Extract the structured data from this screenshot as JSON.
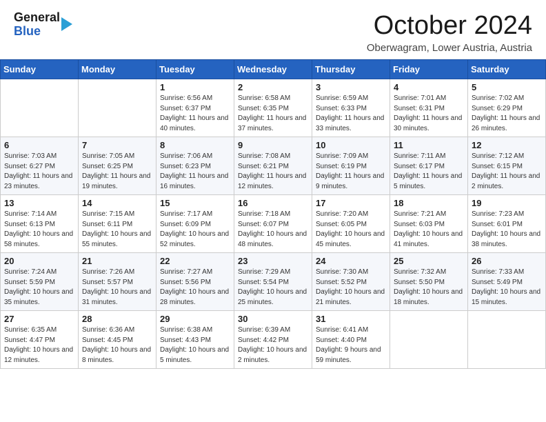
{
  "header": {
    "logo_line1": "General",
    "logo_line2": "Blue",
    "month_title": "October 2024",
    "location": "Oberwagram, Lower Austria, Austria"
  },
  "weekdays": [
    "Sunday",
    "Monday",
    "Tuesday",
    "Wednesday",
    "Thursday",
    "Friday",
    "Saturday"
  ],
  "weeks": [
    [
      {
        "day": "",
        "info": ""
      },
      {
        "day": "",
        "info": ""
      },
      {
        "day": "1",
        "info": "Sunrise: 6:56 AM\nSunset: 6:37 PM\nDaylight: 11 hours and 40 minutes."
      },
      {
        "day": "2",
        "info": "Sunrise: 6:58 AM\nSunset: 6:35 PM\nDaylight: 11 hours and 37 minutes."
      },
      {
        "day": "3",
        "info": "Sunrise: 6:59 AM\nSunset: 6:33 PM\nDaylight: 11 hours and 33 minutes."
      },
      {
        "day": "4",
        "info": "Sunrise: 7:01 AM\nSunset: 6:31 PM\nDaylight: 11 hours and 30 minutes."
      },
      {
        "day": "5",
        "info": "Sunrise: 7:02 AM\nSunset: 6:29 PM\nDaylight: 11 hours and 26 minutes."
      }
    ],
    [
      {
        "day": "6",
        "info": "Sunrise: 7:03 AM\nSunset: 6:27 PM\nDaylight: 11 hours and 23 minutes."
      },
      {
        "day": "7",
        "info": "Sunrise: 7:05 AM\nSunset: 6:25 PM\nDaylight: 11 hours and 19 minutes."
      },
      {
        "day": "8",
        "info": "Sunrise: 7:06 AM\nSunset: 6:23 PM\nDaylight: 11 hours and 16 minutes."
      },
      {
        "day": "9",
        "info": "Sunrise: 7:08 AM\nSunset: 6:21 PM\nDaylight: 11 hours and 12 minutes."
      },
      {
        "day": "10",
        "info": "Sunrise: 7:09 AM\nSunset: 6:19 PM\nDaylight: 11 hours and 9 minutes."
      },
      {
        "day": "11",
        "info": "Sunrise: 7:11 AM\nSunset: 6:17 PM\nDaylight: 11 hours and 5 minutes."
      },
      {
        "day": "12",
        "info": "Sunrise: 7:12 AM\nSunset: 6:15 PM\nDaylight: 11 hours and 2 minutes."
      }
    ],
    [
      {
        "day": "13",
        "info": "Sunrise: 7:14 AM\nSunset: 6:13 PM\nDaylight: 10 hours and 58 minutes."
      },
      {
        "day": "14",
        "info": "Sunrise: 7:15 AM\nSunset: 6:11 PM\nDaylight: 10 hours and 55 minutes."
      },
      {
        "day": "15",
        "info": "Sunrise: 7:17 AM\nSunset: 6:09 PM\nDaylight: 10 hours and 52 minutes."
      },
      {
        "day": "16",
        "info": "Sunrise: 7:18 AM\nSunset: 6:07 PM\nDaylight: 10 hours and 48 minutes."
      },
      {
        "day": "17",
        "info": "Sunrise: 7:20 AM\nSunset: 6:05 PM\nDaylight: 10 hours and 45 minutes."
      },
      {
        "day": "18",
        "info": "Sunrise: 7:21 AM\nSunset: 6:03 PM\nDaylight: 10 hours and 41 minutes."
      },
      {
        "day": "19",
        "info": "Sunrise: 7:23 AM\nSunset: 6:01 PM\nDaylight: 10 hours and 38 minutes."
      }
    ],
    [
      {
        "day": "20",
        "info": "Sunrise: 7:24 AM\nSunset: 5:59 PM\nDaylight: 10 hours and 35 minutes."
      },
      {
        "day": "21",
        "info": "Sunrise: 7:26 AM\nSunset: 5:57 PM\nDaylight: 10 hours and 31 minutes."
      },
      {
        "day": "22",
        "info": "Sunrise: 7:27 AM\nSunset: 5:56 PM\nDaylight: 10 hours and 28 minutes."
      },
      {
        "day": "23",
        "info": "Sunrise: 7:29 AM\nSunset: 5:54 PM\nDaylight: 10 hours and 25 minutes."
      },
      {
        "day": "24",
        "info": "Sunrise: 7:30 AM\nSunset: 5:52 PM\nDaylight: 10 hours and 21 minutes."
      },
      {
        "day": "25",
        "info": "Sunrise: 7:32 AM\nSunset: 5:50 PM\nDaylight: 10 hours and 18 minutes."
      },
      {
        "day": "26",
        "info": "Sunrise: 7:33 AM\nSunset: 5:49 PM\nDaylight: 10 hours and 15 minutes."
      }
    ],
    [
      {
        "day": "27",
        "info": "Sunrise: 6:35 AM\nSunset: 4:47 PM\nDaylight: 10 hours and 12 minutes."
      },
      {
        "day": "28",
        "info": "Sunrise: 6:36 AM\nSunset: 4:45 PM\nDaylight: 10 hours and 8 minutes."
      },
      {
        "day": "29",
        "info": "Sunrise: 6:38 AM\nSunset: 4:43 PM\nDaylight: 10 hours and 5 minutes."
      },
      {
        "day": "30",
        "info": "Sunrise: 6:39 AM\nSunset: 4:42 PM\nDaylight: 10 hours and 2 minutes."
      },
      {
        "day": "31",
        "info": "Sunrise: 6:41 AM\nSunset: 4:40 PM\nDaylight: 9 hours and 59 minutes."
      },
      {
        "day": "",
        "info": ""
      },
      {
        "day": "",
        "info": ""
      }
    ]
  ]
}
